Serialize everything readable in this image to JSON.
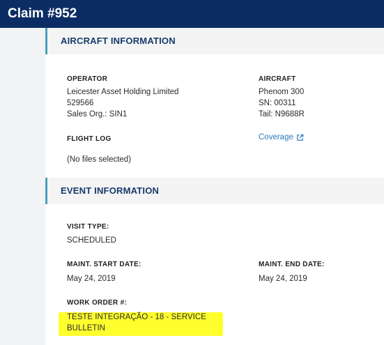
{
  "header": {
    "title": "Claim #952"
  },
  "aircraft_info": {
    "section_title": "AIRCRAFT INFORMATION",
    "operator": {
      "label": "OPERATOR",
      "name": "Leicester Asset Holding Limited",
      "code": "529566",
      "sales_org": "Sales Org.: SIN1"
    },
    "aircraft": {
      "label": "AIRCRAFT",
      "model": "Phenom 300",
      "sn": "SN: 00311",
      "tail": "Tail: N9688R"
    },
    "flight_log": {
      "label": "FLIGHT LOG",
      "value": "(No files selected)"
    },
    "coverage_link": "Coverage"
  },
  "event_info": {
    "section_title": "EVENT INFORMATION",
    "visit_type": {
      "label": "VISIT TYPE:",
      "value": "SCHEDULED"
    },
    "maint_start": {
      "label": "MAINT. START DATE:",
      "value": "May 24, 2019"
    },
    "maint_end": {
      "label": "MAINT. END DATE:",
      "value": "May 24, 2019"
    },
    "work_order": {
      "label": "WORK ORDER #:",
      "line1": "TESTE INTEGRAÇÃO - 18 - SERVICE",
      "line2": "BULLETIN"
    }
  },
  "colors": {
    "header_bg": "#0b2d63",
    "section_accent": "#4a9fbc",
    "link": "#2a7bbf",
    "highlight": "#ffff2e"
  }
}
